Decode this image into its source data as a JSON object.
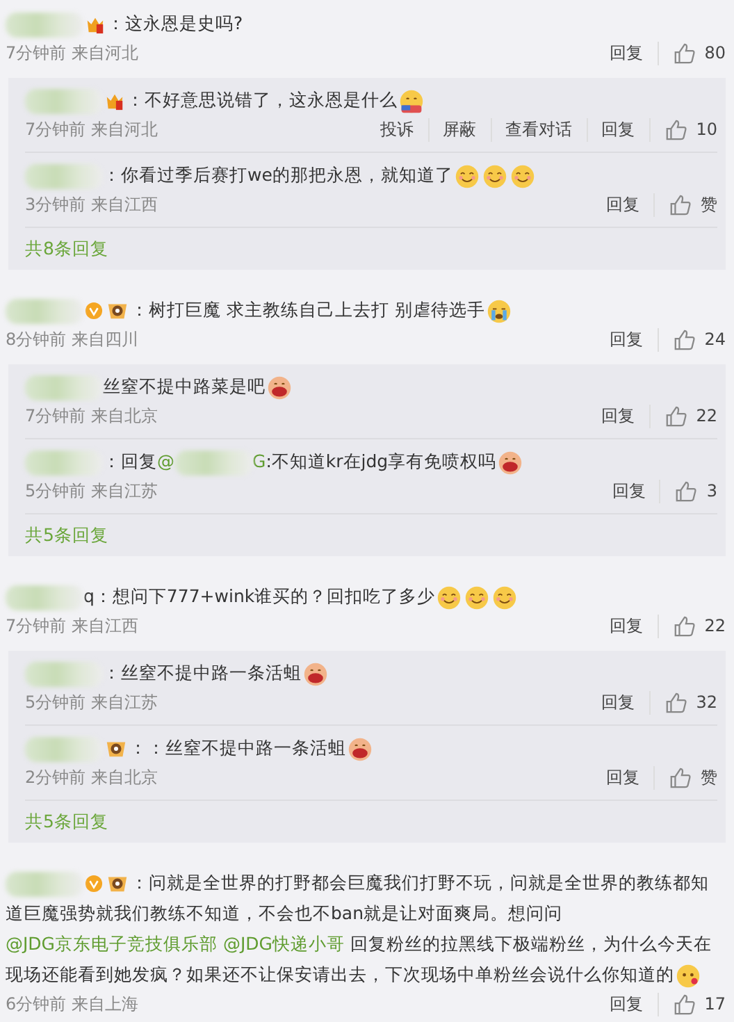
{
  "comments": [
    {
      "segments": [
        {
          "kind": "blur"
        },
        {
          "kind": "crown"
        },
        {
          "kind": "text",
          "text": "：这永恩是史吗?"
        }
      ],
      "time": "7分钟前",
      "location": "来自河北",
      "actions": [
        "回复"
      ],
      "likes": "80",
      "replies": [
        {
          "segments": [
            {
              "kind": "blur"
            },
            {
              "kind": "crown"
            },
            {
              "kind": "text",
              "text": "：不好意思说错了，这永恩是什么"
            },
            {
              "kind": "hug"
            }
          ],
          "time": "7分钟前",
          "location": "来自河北",
          "actions": [
            "投诉",
            "屏蔽",
            "查看对话",
            "回复"
          ],
          "likes": "10"
        },
        {
          "segments": [
            {
              "kind": "blur"
            },
            {
              "kind": "text",
              "text": "：你看过季后赛打we的那把永恩，就知道了"
            },
            {
              "kind": "smile"
            },
            {
              "kind": "smile"
            },
            {
              "kind": "smile"
            }
          ],
          "time": "3分钟前",
          "location": "来自江西",
          "actions": [
            "回复"
          ],
          "likes": "赞"
        }
      ],
      "more": "共8条回复"
    },
    {
      "segments": [
        {
          "kind": "blur"
        },
        {
          "kind": "vip"
        },
        {
          "kind": "medal"
        },
        {
          "kind": "text",
          "text": "：树打巨魔 求主教练自己上去打 别虐待选手"
        },
        {
          "kind": "cry"
        }
      ],
      "time": "8分钟前",
      "location": "来自四川",
      "actions": [
        "回复"
      ],
      "likes": "24",
      "replies": [
        {
          "segments": [
            {
              "kind": "blur"
            },
            {
              "kind": "text",
              "text": "丝窒不提中路菜是吧"
            },
            {
              "kind": "laugh"
            }
          ],
          "time": "7分钟前",
          "location": "来自北京",
          "actions": [
            "回复"
          ],
          "likes": "22"
        },
        {
          "segments": [
            {
              "kind": "blur"
            },
            {
              "kind": "text",
              "text": "：回复"
            },
            {
              "kind": "mention",
              "text": "@"
            },
            {
              "kind": "blur"
            },
            {
              "kind": "mention",
              "text": "G"
            },
            {
              "kind": "text",
              "text": ":不知道kr在jdg享有免喷权吗"
            },
            {
              "kind": "laugh"
            }
          ],
          "time": "5分钟前",
          "location": "来自江苏",
          "actions": [
            "回复"
          ],
          "likes": "3"
        }
      ],
      "more": "共5条回复"
    },
    {
      "segments": [
        {
          "kind": "blur"
        },
        {
          "kind": "text",
          "text": "q：想问下777+wink谁买的？回扣吃了多少"
        },
        {
          "kind": "smile"
        },
        {
          "kind": "smile"
        },
        {
          "kind": "smile"
        }
      ],
      "time": "7分钟前",
      "location": "来自江西",
      "actions": [
        "回复"
      ],
      "likes": "22",
      "replies": [
        {
          "segments": [
            {
              "kind": "blur"
            },
            {
              "kind": "text",
              "text": "：丝窒不提中路一条活蛆"
            },
            {
              "kind": "laugh"
            }
          ],
          "time": "5分钟前",
          "location": "来自江苏",
          "actions": [
            "回复"
          ],
          "likes": "32"
        },
        {
          "segments": [
            {
              "kind": "blur"
            },
            {
              "kind": "medal"
            },
            {
              "kind": "text",
              "text": "：：丝窒不提中路一条活蛆"
            },
            {
              "kind": "laugh"
            }
          ],
          "time": "2分钟前",
          "location": "来自北京",
          "actions": [
            "回复"
          ],
          "likes": "赞"
        }
      ],
      "more": "共5条回复"
    },
    {
      "segments": [
        {
          "kind": "blur"
        },
        {
          "kind": "vip"
        },
        {
          "kind": "medal"
        },
        {
          "kind": "text",
          "text": "：问就是全世界的打野都会巨魔我们打野不玩，问就是全世界的教练都知道巨魔强势就我们教练不知道，不会也不ban就是让对面爽局。想问问"
        },
        {
          "kind": "mention",
          "text": "@JDG京东电子竞技俱乐部 @JDG快递小哥"
        },
        {
          "kind": "text",
          "text": " 回复粉丝的拉黑线下极端粉丝，为什么今天在现场还能看到她发疯？如果还不让保安请出去，下次现场中单粉丝会说什么你知道的"
        },
        {
          "kind": "blush"
        }
      ],
      "time": "6分钟前",
      "location": "来自上海",
      "actions": [
        "回复"
      ],
      "likes": "17"
    }
  ]
}
